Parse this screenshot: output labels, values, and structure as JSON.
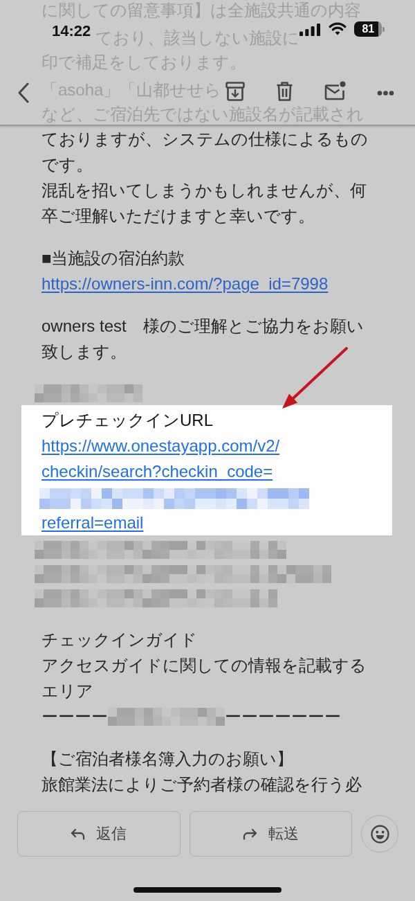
{
  "status_bar": {
    "time": "14:22",
    "battery": "81"
  },
  "scrolled_text": {
    "lines": [
      "に関しての留意事項】は全施設共通の内容",
      "ており、該当しない施設に",
      "印で補足をしております。",
      "「asoha」「山都せせら",
      "など、ご宿泊先ではない施設名が記載され"
    ]
  },
  "paragraphs": [
    {
      "highlighted": false,
      "items": [
        {
          "kind": "text",
          "lines": [
            "ておりますが、システムの仕様によるもの",
            "です。",
            "混乱を招いてしまうかもしれませんが、何",
            "卒ご理解いただけますと幸いです。"
          ]
        }
      ]
    },
    {
      "highlighted": false,
      "items": [
        {
          "kind": "text",
          "lines": [
            "■当施設の宿泊約款"
          ]
        },
        {
          "kind": "link",
          "lines": [
            {
              "kind": "text",
              "text": "https://owners-inn.com/?page_id=7998"
            }
          ]
        }
      ]
    },
    {
      "highlighted": false,
      "items": [
        {
          "kind": "text",
          "lines": [
            "owners test　様のご理解とご協力をお願い",
            "致します。"
          ]
        }
      ]
    },
    {
      "highlighted": false,
      "items": [
        {
          "kind": "redacted"
        }
      ]
    },
    {
      "highlighted": true,
      "items": [
        {
          "kind": "text",
          "lines": [
            "プレチェックインURL"
          ]
        },
        {
          "kind": "link",
          "lines": [
            {
              "kind": "text",
              "text": "https://www.onestayapp.com/v2/"
            },
            {
              "kind": "text",
              "text": "checkin/search?checkin_code="
            },
            {
              "kind": "redacted"
            },
            {
              "kind": "text",
              "text": "referral=email"
            }
          ]
        }
      ]
    },
    {
      "highlighted": false,
      "items": [
        {
          "kind": "redacted"
        },
        {
          "kind": "redacted"
        },
        {
          "kind": "redacted"
        }
      ]
    },
    {
      "highlighted": false,
      "items": [
        {
          "kind": "text",
          "lines": [
            "チェックインガイド",
            "アクセスガイドに関しての情報を記載する",
            "エリア"
          ]
        },
        {
          "kind": "divider",
          "before": "ーーーー",
          "after": "ーーーーーーー"
        }
      ]
    },
    {
      "highlighted": false,
      "items": [
        {
          "kind": "text",
          "lines": [
            "【ご宿泊者様名簿入力のお願い】",
            "旅館業法によりご予約者様の確認を行う必"
          ]
        }
      ]
    }
  ],
  "actions": [
    {
      "kind": "reply",
      "label": "返信"
    },
    {
      "kind": "forward",
      "label": "転送"
    }
  ]
}
